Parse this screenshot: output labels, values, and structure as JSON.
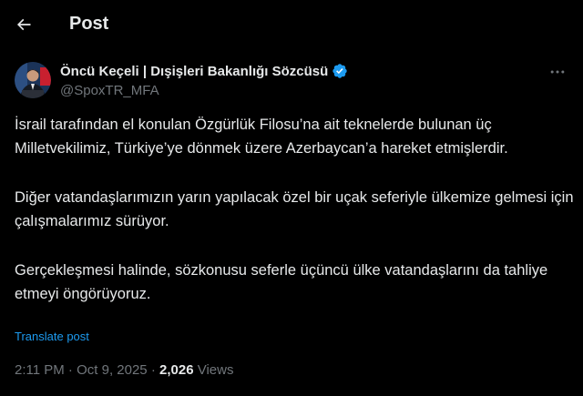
{
  "header": {
    "title": "Post",
    "back_icon": "arrow-left-icon"
  },
  "author": {
    "display_name": "Öncü Keçeli | Dışişleri Bakanlığı Sözcüsü",
    "handle": "@SpoxTR_MFA",
    "verified_icon": "verified-badge-icon",
    "verified_color": "#1d9bf0"
  },
  "more_icon": "more-horizontal-icon",
  "tweet": {
    "paragraphs": [
      "İsrail tarafından el konulan Özgürlük Filosu’na ait teknelerde bulunan üç Milletvekilimiz, Türkiye’ye dönmek üzere Azerbaycan’a hareket etmişlerdir.",
      "Diğer vatandaşlarımızın yarın yapılacak özel bir uçak seferiyle ülkemize gelmesi için çalışmalarımız sürüyor.",
      "Gerçekleşmesi halinde, sözkonusu seferle üçüncü ülke vatandaşlarını da tahliye etmeyi öngörüyoruz."
    ],
    "translate_label": "Translate post"
  },
  "meta": {
    "time": "2:11 PM",
    "separator": "·",
    "date": "Oct 9, 2025",
    "views_count": "2,026",
    "views_label": "Views"
  },
  "colors": {
    "background": "#000000",
    "text": "#e7e9ea",
    "muted": "#71767b",
    "accent": "#1d9bf0"
  }
}
